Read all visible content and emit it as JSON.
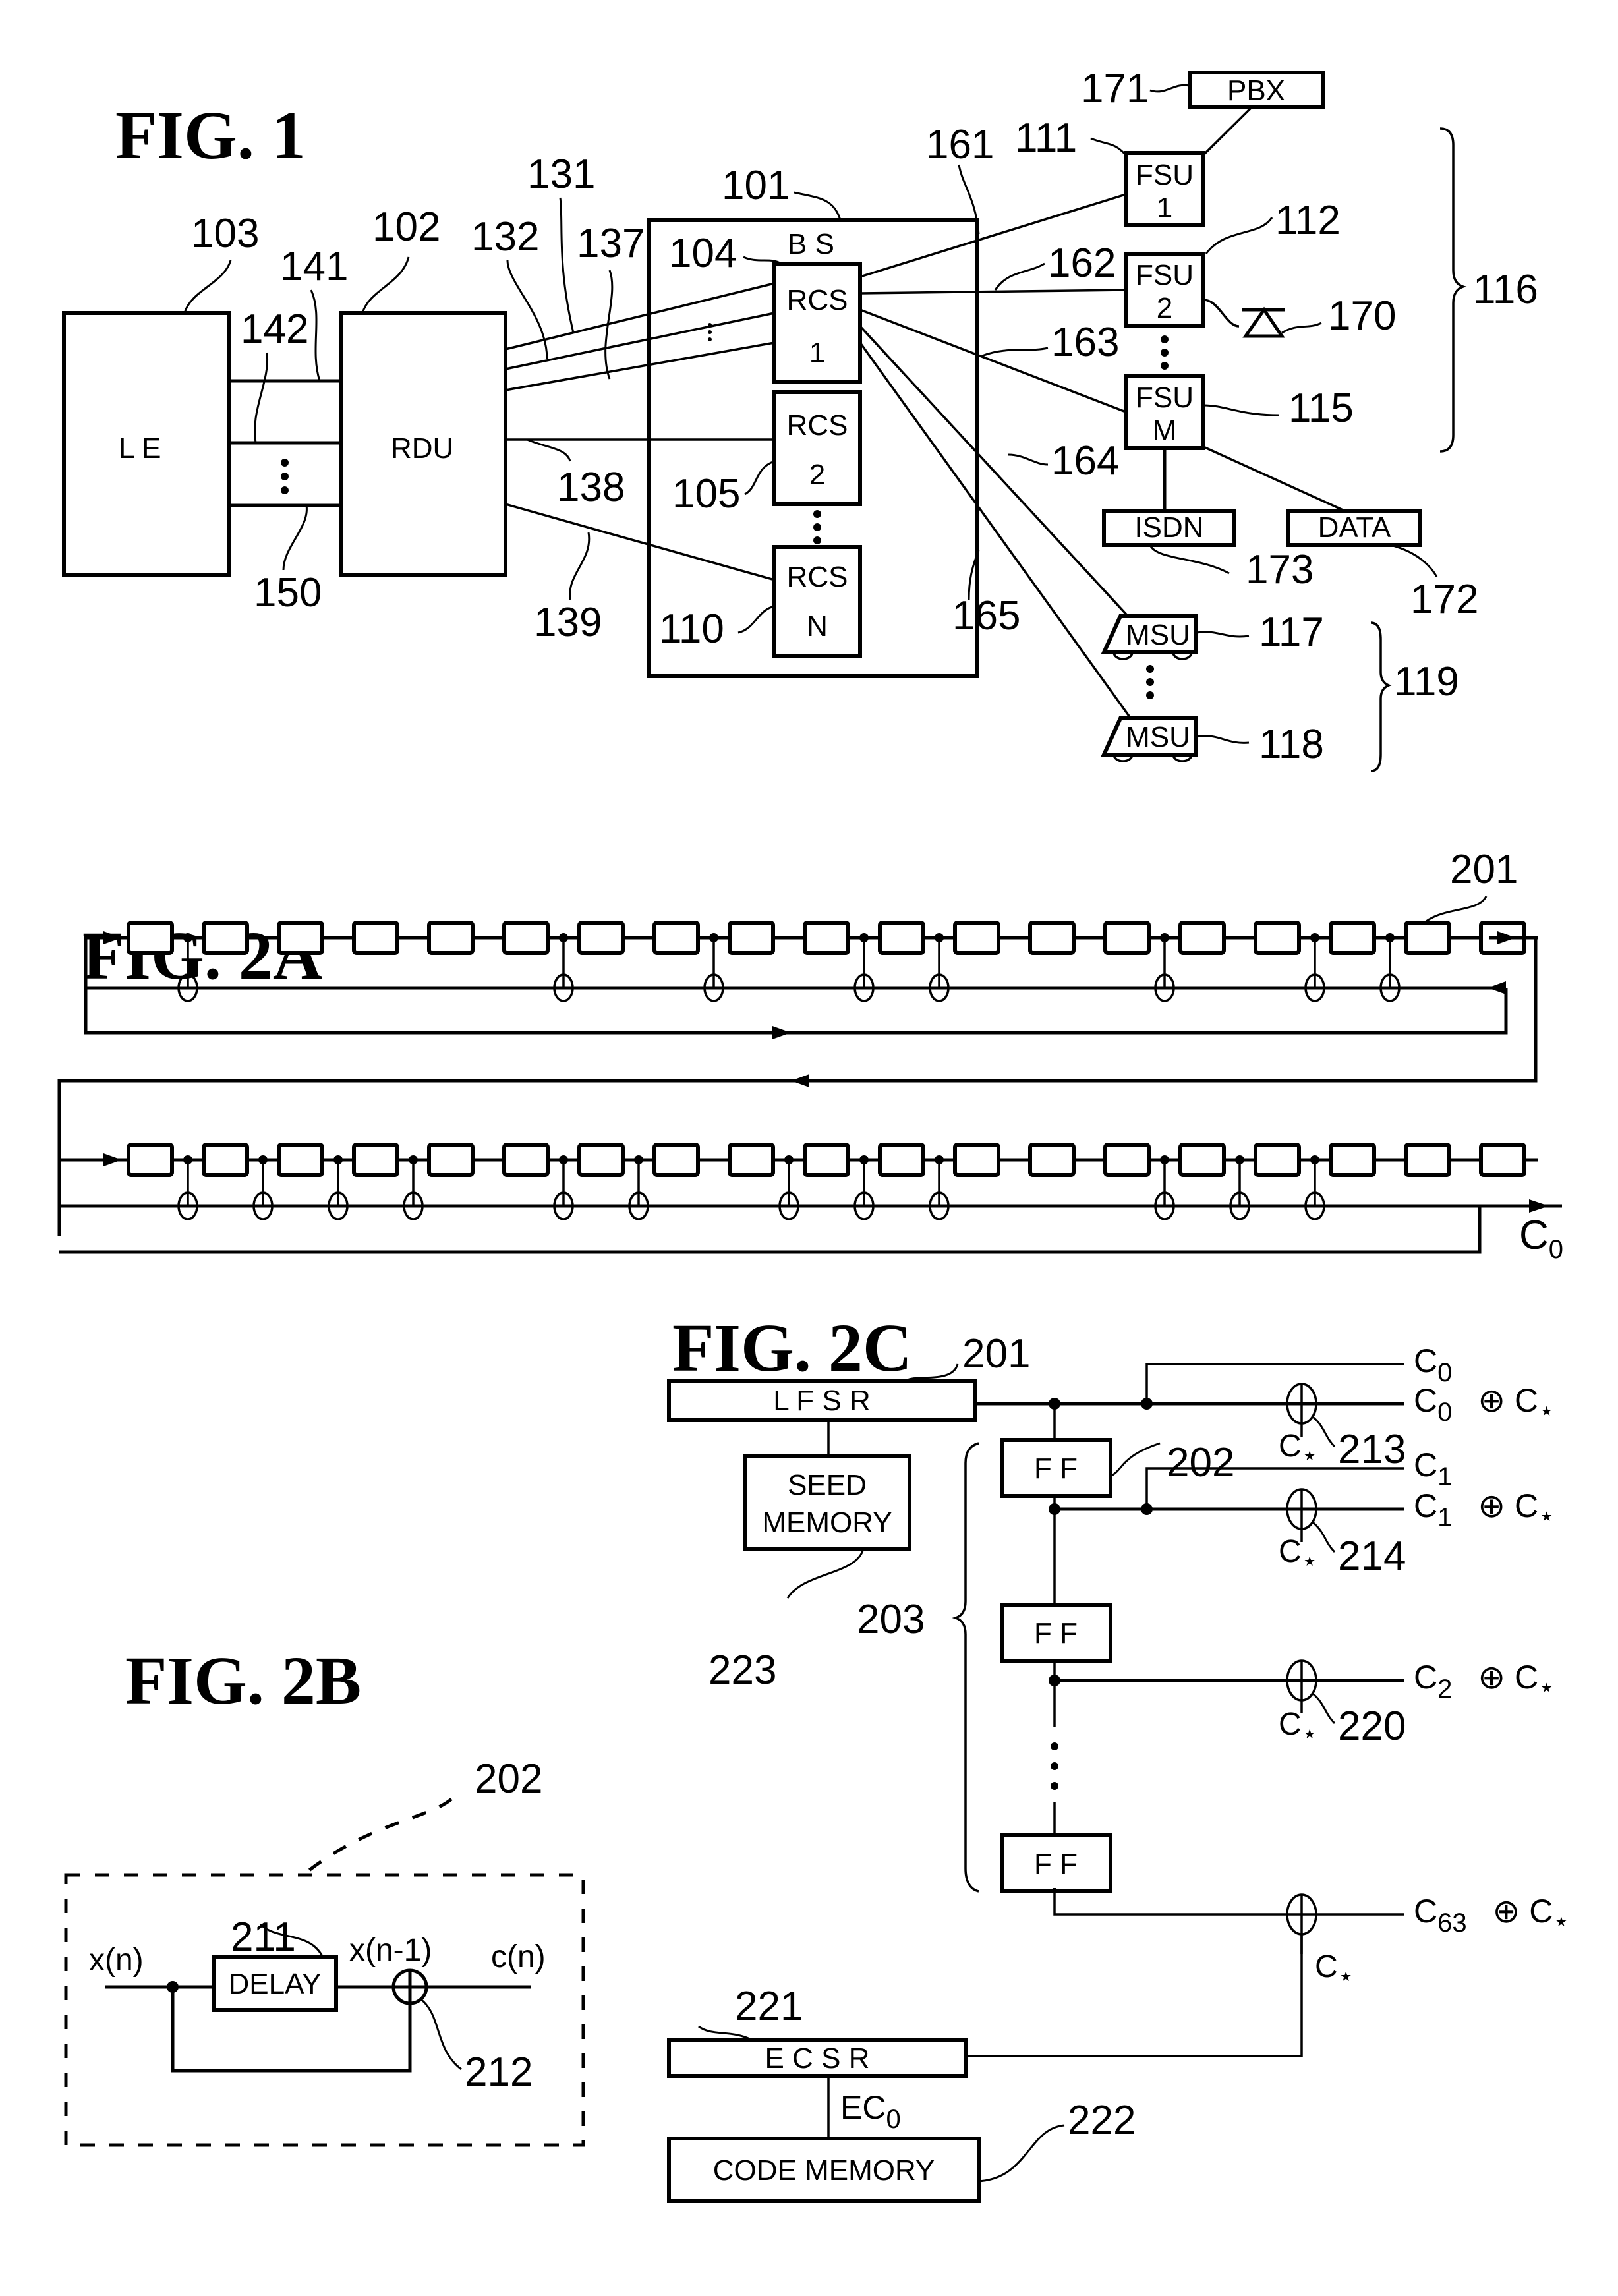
{
  "fig1": {
    "title": "FIG. 1",
    "blocks": {
      "le": "L E",
      "rdu": "RDU",
      "bs": "B S",
      "rcs1": [
        "RCS",
        "1"
      ],
      "rcs2": [
        "RCS",
        "2"
      ],
      "rcsN": [
        "RCS",
        "N"
      ],
      "fsu1": [
        "FSU",
        "1"
      ],
      "fsu2": [
        "FSU",
        "2"
      ],
      "fsuM": [
        "FSU",
        "M"
      ],
      "pbx": "PBX",
      "isdn": "ISDN",
      "data": "DATA",
      "msu1": "MSU",
      "msu2": "MSU"
    },
    "refs": {
      "r101": "101",
      "r102": "102",
      "r103": "103",
      "r104": "104",
      "r105": "105",
      "r110": "110",
      "r111": "111",
      "r112": "112",
      "r115": "115",
      "r116": "116",
      "r117": "117",
      "r118": "118",
      "r119": "119",
      "r131": "131",
      "r132": "132",
      "r137": "137",
      "r138": "138",
      "r139": "139",
      "r141": "141",
      "r142": "142",
      "r150": "150",
      "r161": "161",
      "r162": "162",
      "r163": "163",
      "r164": "164",
      "r165": "165",
      "r170": "170",
      "r171": "171",
      "r172": "172",
      "r173": "173"
    }
  },
  "fig2a": {
    "title": "FIG. 2A",
    "ref": "201",
    "cells_per_row": 19,
    "top_row_taps_after_cell": [
      1,
      6,
      8,
      10,
      11,
      14,
      16,
      17
    ],
    "bottom_row_taps_after_cell": [
      1,
      2,
      3,
      4,
      6,
      7,
      9,
      10,
      11,
      14,
      15,
      16
    ],
    "output_label": "C",
    "output_sub": "0"
  },
  "fig2b": {
    "title": "FIG. 2B",
    "delay_label": "DELAY",
    "input_label": "x(n)",
    "delayed_label": "x(n-1)",
    "output_label": "c(n)",
    "refs": {
      "r202": "202",
      "r211": "211",
      "r212": "212"
    }
  },
  "fig2c": {
    "title": "FIG. 2C",
    "lfsr_label": "L F S R",
    "seed_memory": [
      "SEED",
      "MEMORY"
    ],
    "ff_label": "F F",
    "ecsr_label": "E C S R",
    "code_memory": "CODE MEMORY",
    "ec0_label": "EC",
    "ec0_sub": "0",
    "outputs": [
      {
        "plain": "C",
        "sub": "0",
        "xor": false
      },
      {
        "plain": "C",
        "sub": "0",
        "xor": true
      },
      {
        "plain": "C",
        "sub": "1",
        "xor": false
      },
      {
        "plain": "C",
        "sub": "1",
        "xor": true
      },
      {
        "plain": "C",
        "sub": "2",
        "xor": true
      },
      {
        "plain": "C",
        "sub": "63",
        "xor": true
      }
    ],
    "xor_suffix": "⊕ C",
    "star": "⋆",
    "c_star": "C",
    "refs": {
      "r201": "201",
      "r202": "202",
      "r203": "203",
      "r213": "213",
      "r214": "214",
      "r220": "220",
      "r221": "221",
      "r222": "222",
      "r223": "223"
    }
  }
}
